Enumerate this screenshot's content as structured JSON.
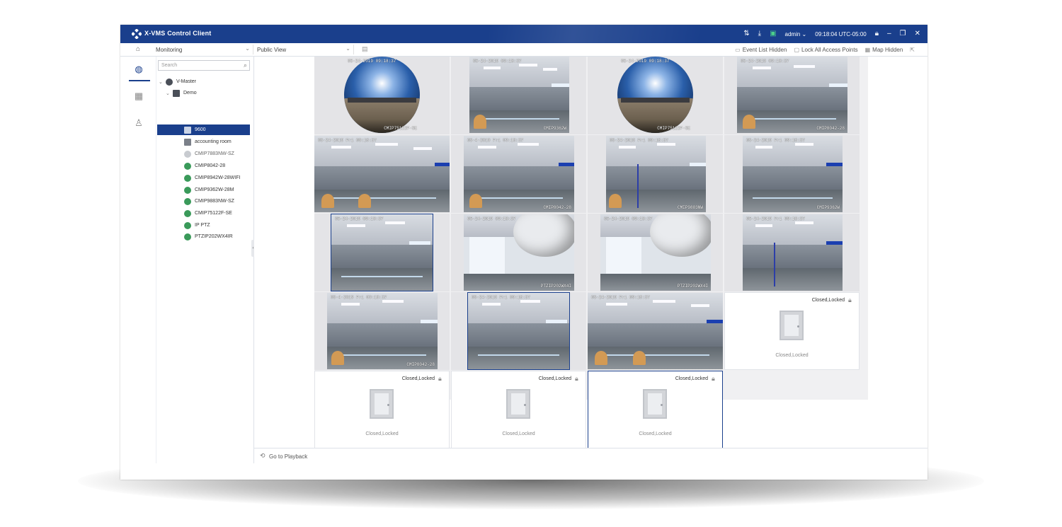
{
  "app": {
    "title": "X-VMS Control Client",
    "user": "admin",
    "time": "09:18:04 UTC-05:00",
    "accent": "#1a3f8c"
  },
  "titlebar_icons": [
    "transfer-icon",
    "download-icon",
    "screen-icon",
    "lock-icon",
    "minimize-icon",
    "restore-icon",
    "close-icon"
  ],
  "toolbar": {
    "mode": "Monitoring",
    "view": "Public View",
    "event_list": "Event List Hidden",
    "lock_all": "Lock All Access Points",
    "map": "Map Hidden"
  },
  "sidebar": {
    "search_placeholder": "Search"
  },
  "tree": {
    "root": "V-Master",
    "group": "Demo",
    "items": [
      "9600",
      "accounting room",
      "CMIP7883NW-SZ",
      "CMIP8042-28",
      "CMIP8942W-28WIFI",
      "CMIP9362W-28M",
      "CMIP9883NW-SZ",
      "CMIP75122F-SE",
      "IP PTZ",
      "PTZIP202WX4IR"
    ]
  },
  "tiles": [
    {
      "stamp": "05-24-2019 09:18:37",
      "name": "CMIP75122F-SE",
      "kind": "fisheye"
    },
    {
      "stamp": "05-24-2019 09:18:37",
      "name": "CMIP9362W",
      "kind": "office"
    },
    {
      "stamp": "05-24-2019 09:18:37",
      "name": "CMIP75122F-SE",
      "kind": "fisheye"
    },
    {
      "stamp": "05-24-2019 09:18:37",
      "name": "CMIP8042-28",
      "kind": "office"
    },
    {
      "stamp": "05-24-2019 Fri 09:18:37",
      "name": "",
      "kind": "office"
    },
    {
      "stamp": "05-4-2019 Fri 09:18:37",
      "name": "CMIP8042-28",
      "kind": "office"
    },
    {
      "stamp": "05-24-2019 Fri 09:18:37",
      "name": "CMIP9883NW",
      "kind": "office"
    },
    {
      "stamp": "05-24-2019 Fri 09:18:37",
      "name": "CMIP9362W",
      "kind": "office"
    },
    {
      "stamp": "05-24-2019 09:18:37",
      "name": "",
      "kind": "office"
    },
    {
      "stamp": "05-24-2019 09:18:37",
      "name": "PTZIP202WX4I",
      "kind": "ptz"
    },
    {
      "stamp": "05-24-2019 09:18:37",
      "name": "PTZIP202WX4I",
      "kind": "ptz"
    },
    {
      "stamp": "05-24-2019 Fri 09:18:37",
      "name": "",
      "kind": "office"
    },
    {
      "stamp": "05-4-2019 Fri 09:18:37",
      "name": "CMIP8042-28",
      "kind": "office"
    },
    {
      "stamp": "05-24-2019 Fri 09:18:37",
      "name": "",
      "kind": "office"
    },
    {
      "stamp": "05-24-2019 Fri 09:18:37",
      "name": "",
      "kind": "office"
    }
  ],
  "doors": {
    "status": "Closed,Locked"
  },
  "playback": {
    "label": "Go to Playback"
  }
}
